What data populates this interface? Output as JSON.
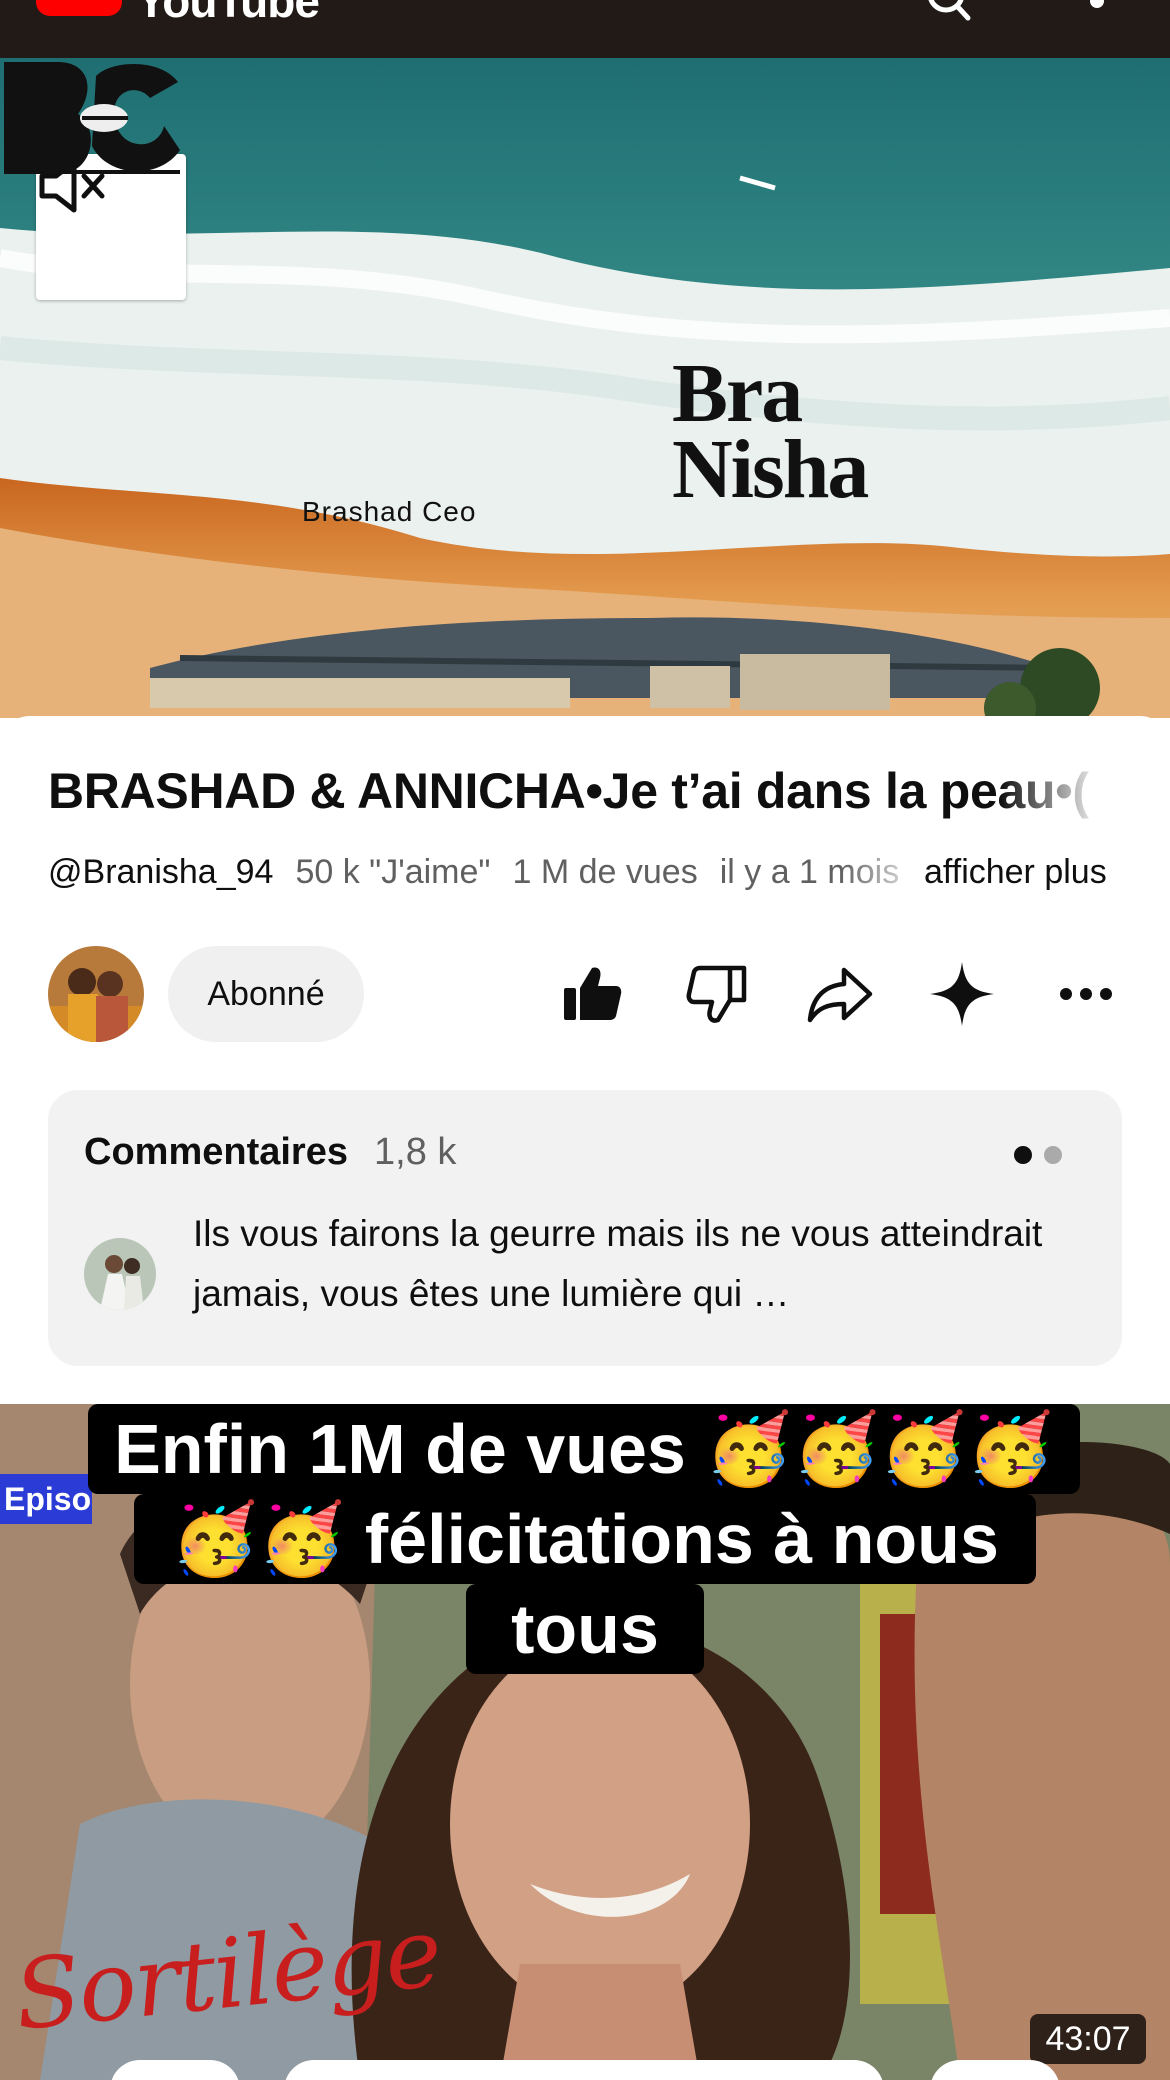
{
  "app": {
    "name": "YouTube",
    "colors": {
      "brand": "#ff0000",
      "topbar": "#211a17",
      "accent_text": "#0f0f0f",
      "muted_text": "#606060"
    }
  },
  "topbar": {
    "logo_text": "YouTube",
    "icons": [
      "youtube-logo-icon",
      "search-icon",
      "more-vertical-icon"
    ]
  },
  "player": {
    "mute_icon": "volume-muted-icon",
    "logo_left_caption": "Brashad Ceo",
    "logo_right_line1": "Bra",
    "logo_right_line2": "Nisha"
  },
  "video": {
    "title": "BRASHAD & ANNICHA•Je t’ai dans la peau•(",
    "channel_handle": "@Branisha_94",
    "likes": "50 k \"J'aime\"",
    "views": "1 M de vues",
    "age": "il y a 1 mois",
    "more_label": "afficher plus"
  },
  "channel_row": {
    "subscribe_label": "Abonné",
    "actions": [
      "like-icon",
      "dislike-icon",
      "share-icon",
      "ask-sparkle-icon",
      "more-horizontal-icon"
    ]
  },
  "comments": {
    "title": "Commentaires",
    "count": "1,8 k",
    "top_comment": "Ils vous fairons la geurre mais ils ne vous atteindrait jamais, vous êtes une lumière qui …"
  },
  "next_short": {
    "badge": "Episod",
    "caption_line1": "Enfin 1M de vues 🥳🥳🥳🥳",
    "caption_line2": "🥳🥳 félicitations à nous",
    "caption_line3": "tous",
    "watermark": "Sortilège",
    "duration": "43:07"
  }
}
